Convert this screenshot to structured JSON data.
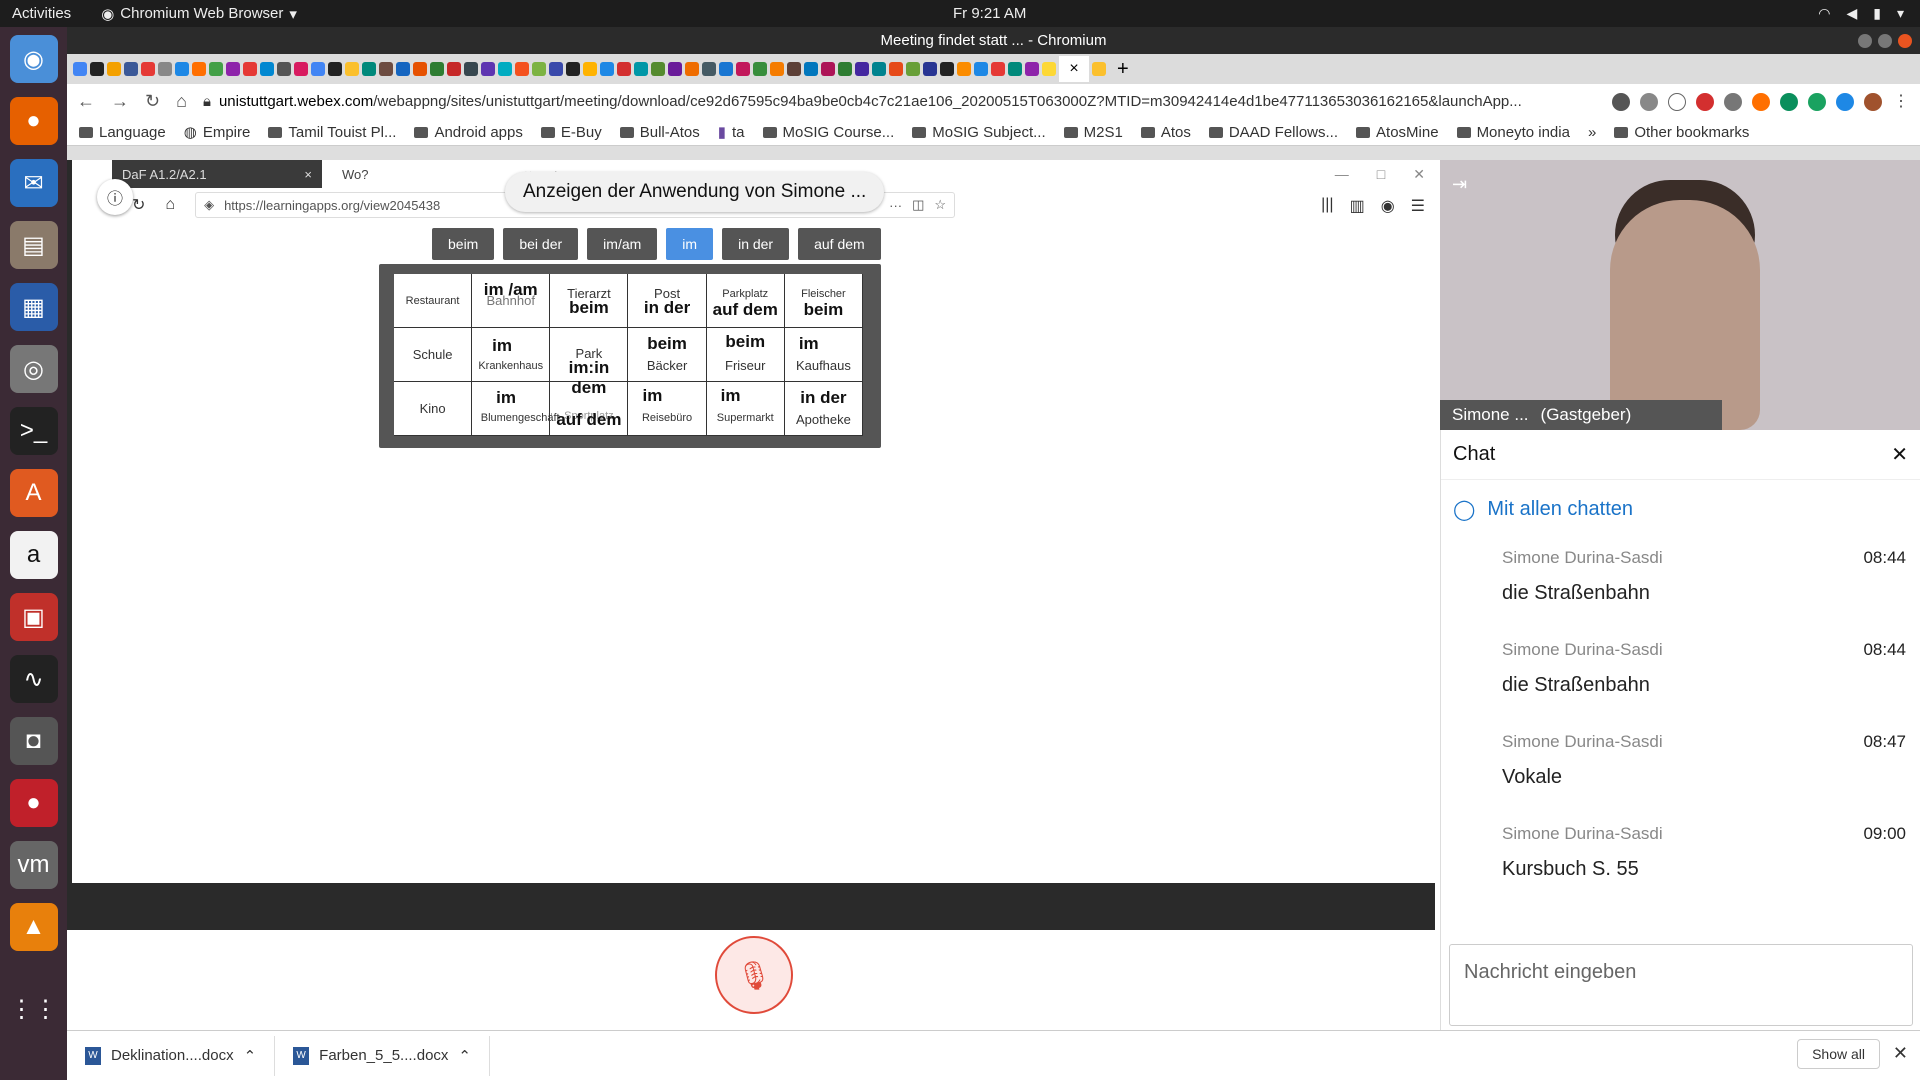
{
  "topbar": {
    "activities": "Activities",
    "app": "Chromium Web Browser",
    "app_arrow": "▾",
    "clock": "Fr  9:21 AM"
  },
  "window": {
    "title": "Meeting findet statt ... - Chromium",
    "url_host": "unistuttgart.webex.com",
    "url_path": "/webappng/sites/unistuttgart/meeting/download/ce92d67595c94ba9be0cb4c7c21ae106_20200515T063000Z?MTID=m30942414e4d1be477113653036162165&launchApp..."
  },
  "bookmarks": [
    {
      "label": "Language"
    },
    {
      "label": "Empire"
    },
    {
      "label": "Tamil Touist Pl..."
    },
    {
      "label": "Android apps"
    },
    {
      "label": "E-Buy"
    },
    {
      "label": "Bull-Atos"
    },
    {
      "label": "ta"
    },
    {
      "label": "MoSIG Course..."
    },
    {
      "label": "MoSIG Subject..."
    },
    {
      "label": "M2S1"
    },
    {
      "label": "Atos"
    },
    {
      "label": "DAAD Fellows..."
    },
    {
      "label": "AtosMine"
    },
    {
      "label": "Moneyto india"
    }
  ],
  "bookmarks_more": "»",
  "other_bookmarks": "Other bookmarks",
  "shared": {
    "toast": "Anzeigen der Anwendung von Simone ...",
    "firefox_tabs": [
      {
        "label": "DaF A1.2/A2.1"
      },
      {
        "label": "Wo?"
      }
    ],
    "firefox_url": "https://learningapps.org/view2045438",
    "answers": [
      "beim",
      "bei der",
      "im/am",
      "im",
      "in der",
      "auf dem"
    ],
    "selected_answer": "im",
    "puzzle": [
      {
        "place": "Restaurant",
        "answer": ""
      },
      {
        "place": "Bahnhof",
        "answer": "im /am"
      },
      {
        "place": "Tierarzt",
        "answer": "beim"
      },
      {
        "place": "Post",
        "answer": "in der"
      },
      {
        "place": "Parkplatz",
        "answer": "auf dem"
      },
      {
        "place": "Fleischer",
        "answer": "beim"
      },
      {
        "place": "Schule",
        "answer": ""
      },
      {
        "place": "Krankenhaus",
        "answer": "im"
      },
      {
        "place": "Park",
        "answer": "im:in dem"
      },
      {
        "place": "Bäcker",
        "answer": "beim"
      },
      {
        "place": "Friseur",
        "answer": "beim"
      },
      {
        "place": "Kaufhaus",
        "answer": "im"
      },
      {
        "place": "Kino",
        "answer": ""
      },
      {
        "place": "Blumengeschäft",
        "answer": "im"
      },
      {
        "place": "Sportplatz",
        "answer": "auf dem"
      },
      {
        "place": "Reisebüro",
        "answer": "im"
      },
      {
        "place": "Supermarkt",
        "answer": "im"
      },
      {
        "place": "Apotheke",
        "answer": "in der"
      }
    ]
  },
  "video": {
    "name": "Simone ...",
    "role": "(Gastgeber)"
  },
  "chat": {
    "title": "Chat",
    "to": "Mit allen chatten",
    "messages": [
      {
        "sender": "Simone Durina-Sasdi",
        "time": "08:44",
        "text": "die Straßenbahn"
      },
      {
        "sender": "Simone Durina-Sasdi",
        "time": "08:44",
        "text": "die Straßenbahn"
      },
      {
        "sender": "Simone Durina-Sasdi",
        "time": "08:47",
        "text": "Vokale"
      },
      {
        "sender": "Simone Durina-Sasdi",
        "time": "09:00",
        "text": "Kursbuch S. 55"
      }
    ],
    "input_placeholder": "Nachricht eingeben"
  },
  "downloads": [
    {
      "name": "Deklination....docx"
    },
    {
      "name": "Farben_5_5....docx"
    }
  ],
  "show_all": "Show all"
}
